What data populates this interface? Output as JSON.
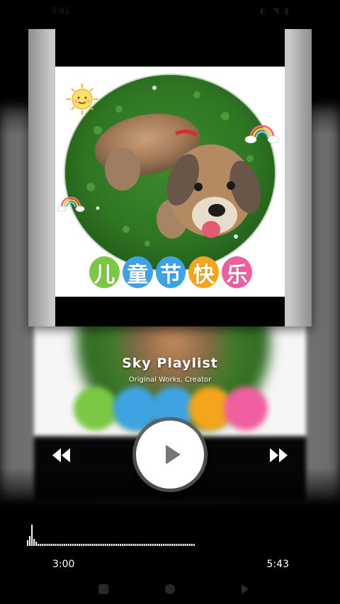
{
  "status_bar": {
    "time": "9:41",
    "icons": "◐ ◥ ▮"
  },
  "album_art": {
    "title_characters": [
      {
        "char": "儿",
        "color": "#7cc743"
      },
      {
        "char": "童",
        "color": "#3fa3e3"
      },
      {
        "char": "节",
        "color": "#3fa3e3"
      },
      {
        "char": "快",
        "color": "#f4a51c"
      },
      {
        "char": "乐",
        "color": "#ef5fa0"
      }
    ]
  },
  "track": {
    "title": "Sky Playlist",
    "subtitle": "Original Works, Creator"
  },
  "controls": {
    "previous_icon": "rewind-icon",
    "play_icon": "play-icon",
    "next_icon": "fast-forward-icon"
  },
  "progress": {
    "current_time": "3:00",
    "total_time": "5:43",
    "fraction": 0.52
  },
  "nav_bar": {
    "back_icon": "back-icon",
    "home_icon": "home-icon",
    "recents_icon": "recents-icon"
  }
}
